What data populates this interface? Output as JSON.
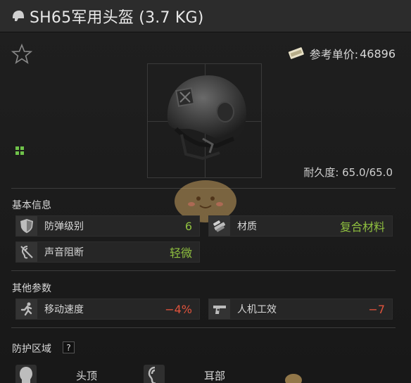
{
  "title": "SH65军用头盔 (3.7 KG)",
  "price": {
    "label": "参考单价:",
    "value": "46896"
  },
  "durability": "耐久度: 65.0/65.0",
  "sections": {
    "basic": "基本信息",
    "other": "其他参数",
    "protection": "防护区域"
  },
  "stats": {
    "armor_class": {
      "label": "防弹级别",
      "value": "6",
      "icon": "shield-icon"
    },
    "material": {
      "label": "材质",
      "value": "复合材料",
      "icon": "material-icon"
    },
    "sound": {
      "label": "声音阻断",
      "value": "轻微",
      "icon": "ear-muted-icon"
    },
    "move_speed": {
      "label": "移动速度",
      "value": "−4%",
      "icon": "running-icon"
    },
    "ergonomics": {
      "label": "人机工效",
      "value": "−7",
      "icon": "pistol-icon"
    }
  },
  "zones": [
    {
      "label": "头顶",
      "icon": "head-top-icon"
    },
    {
      "label": "耳部",
      "icon": "ear-icon"
    }
  ],
  "help_label": "?",
  "colors": {
    "positive": "#8fbf3f",
    "negative": "#e0533c",
    "accent_green": "#6fc24a"
  }
}
